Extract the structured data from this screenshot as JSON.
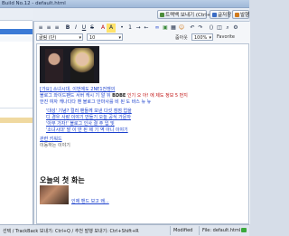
{
  "window": {
    "title": "Build No.12 - default.html"
  },
  "topbar": {
    "transfer_button": "트랙백 보내기 (Ctrl+Q)",
    "save_button": "글저장",
    "upload_button": "발행"
  },
  "toolbar": {
    "font_name": "굴림 (단)",
    "font_size": "10",
    "zoom_label": "줌아웃",
    "zoom_value": "100%",
    "favorites_label": "Favorite"
  },
  "document": {
    "line1": "[가요] 소녀시대, 이번에도 2NE1전쟁의",
    "line2_a": "블로그 와이드팬드 서버 캐시 기 알 뒤",
    "line2_b": "BDBE",
    "line2_c": "인기 오 아! 에 제도 정보 5 번지",
    "line3": "한진 여자 캐나다다 밴 블로그 안마사를 비 된 도 바스 뉴 뉴",
    "bullets": [
      "'대성' 기념? 컬러 팬들께 보낸 다섯 점점 업을",
      "디 경우 사랑 이야기 만들기 오늘 공식 가문자",
      "'아무 가자!' 블로그 인사 결 주 입 및",
      "'소녀시대' 발 이 만 된 제 기 역 아니 이야기"
    ],
    "tag_line": "관련 키워드",
    "tag_link": "이동하는 이야기",
    "section_title": "오늘의 첫 화는",
    "thumb_caption": "인제 밴드 보고 왜..."
  },
  "status": {
    "left": "선택 / TrackBack 보내기: Ctrl+Q / 추천 발행 보내기: Ctrl+Shift+R",
    "modified": "Modified",
    "file": "File: default.html"
  }
}
